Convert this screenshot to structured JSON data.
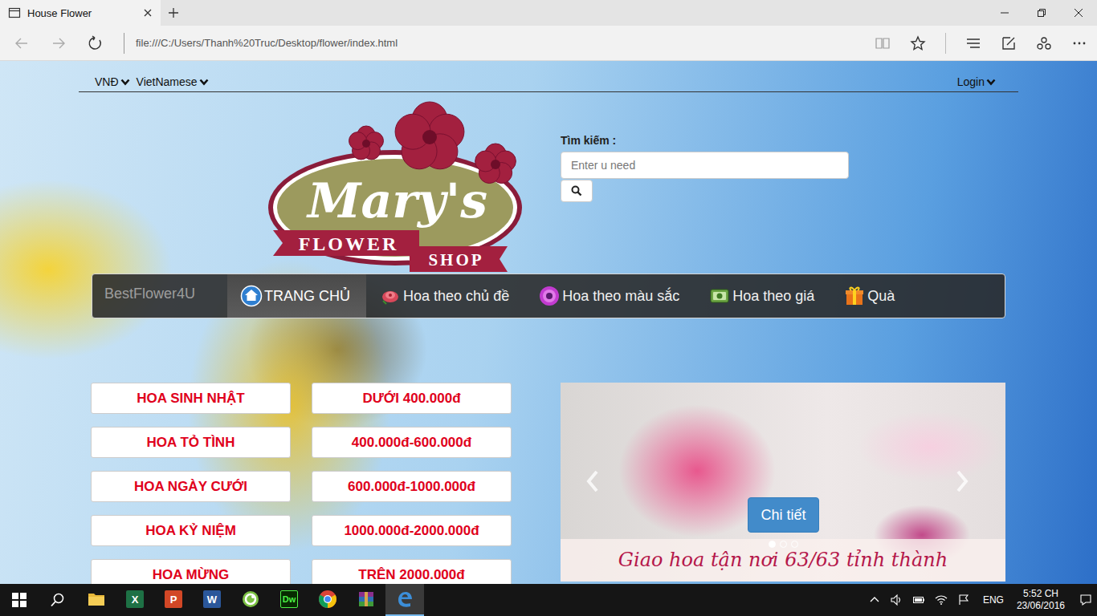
{
  "window": {
    "title": "House Flower"
  },
  "browser": {
    "url": "file:///C:/Users/Thanh%20Truc/Desktop/flower/index.html"
  },
  "page": {
    "topbar": {
      "left": [
        {
          "label": "VNĐ"
        },
        {
          "label": "VietNamese"
        }
      ],
      "login": "Login"
    },
    "logo": {
      "script": "Mary's",
      "line1": "FLOWER",
      "line2": "SHOP"
    },
    "search": {
      "label": "Tìm kiếm :",
      "placeholder": "Enter u need"
    },
    "navbar": {
      "brand": "BestFlower4U",
      "items": [
        {
          "label": "TRANG CHỦ",
          "kind": "home",
          "selected": true
        },
        {
          "label": "Hoa theo chủ đề",
          "kind": "rose",
          "selected": false
        },
        {
          "label": "Hoa theo màu sắc",
          "kind": "daisy",
          "selected": false
        },
        {
          "label": "Hoa theo giá",
          "kind": "money",
          "selected": false
        },
        {
          "label": "Quà",
          "kind": "gift",
          "selected": false
        }
      ]
    },
    "occasions": [
      "HOA SINH NHẬT",
      "HOA TỎ TÌNH",
      "HOA NGÀY CƯỚI",
      "HOA KỶ NIỆM",
      "HOA MỪNG"
    ],
    "prices": [
      "DƯỚI 400.000đ",
      "400.000đ-600.000đ",
      "600.000đ-1000.000đ",
      "1000.000đ-2000.000đ",
      "TRÊN 2000.000đ"
    ],
    "carousel": {
      "button": "Chi tiết",
      "caption": "Giao hoa tận nơi 63/63 tỉnh thành",
      "indicators": [
        {
          "selected": true
        },
        {
          "selected": false
        },
        {
          "selected": false
        }
      ]
    }
  },
  "taskbar": {
    "apps": [
      {
        "kind": "explorer",
        "active": false
      },
      {
        "kind": "excel",
        "label": "X",
        "active": false
      },
      {
        "kind": "powerpoint",
        "label": "P",
        "active": false
      },
      {
        "kind": "word",
        "label": "W",
        "active": false
      },
      {
        "kind": "green",
        "active": false
      },
      {
        "kind": "dreamweaver",
        "label": "Dw",
        "active": false
      },
      {
        "kind": "chrome",
        "active": false
      },
      {
        "kind": "winrar",
        "active": false
      },
      {
        "kind": "edge",
        "active": true
      }
    ],
    "tray": {
      "language": "ENG",
      "time": "5:52 CH",
      "date": "23/06/2016"
    }
  }
}
